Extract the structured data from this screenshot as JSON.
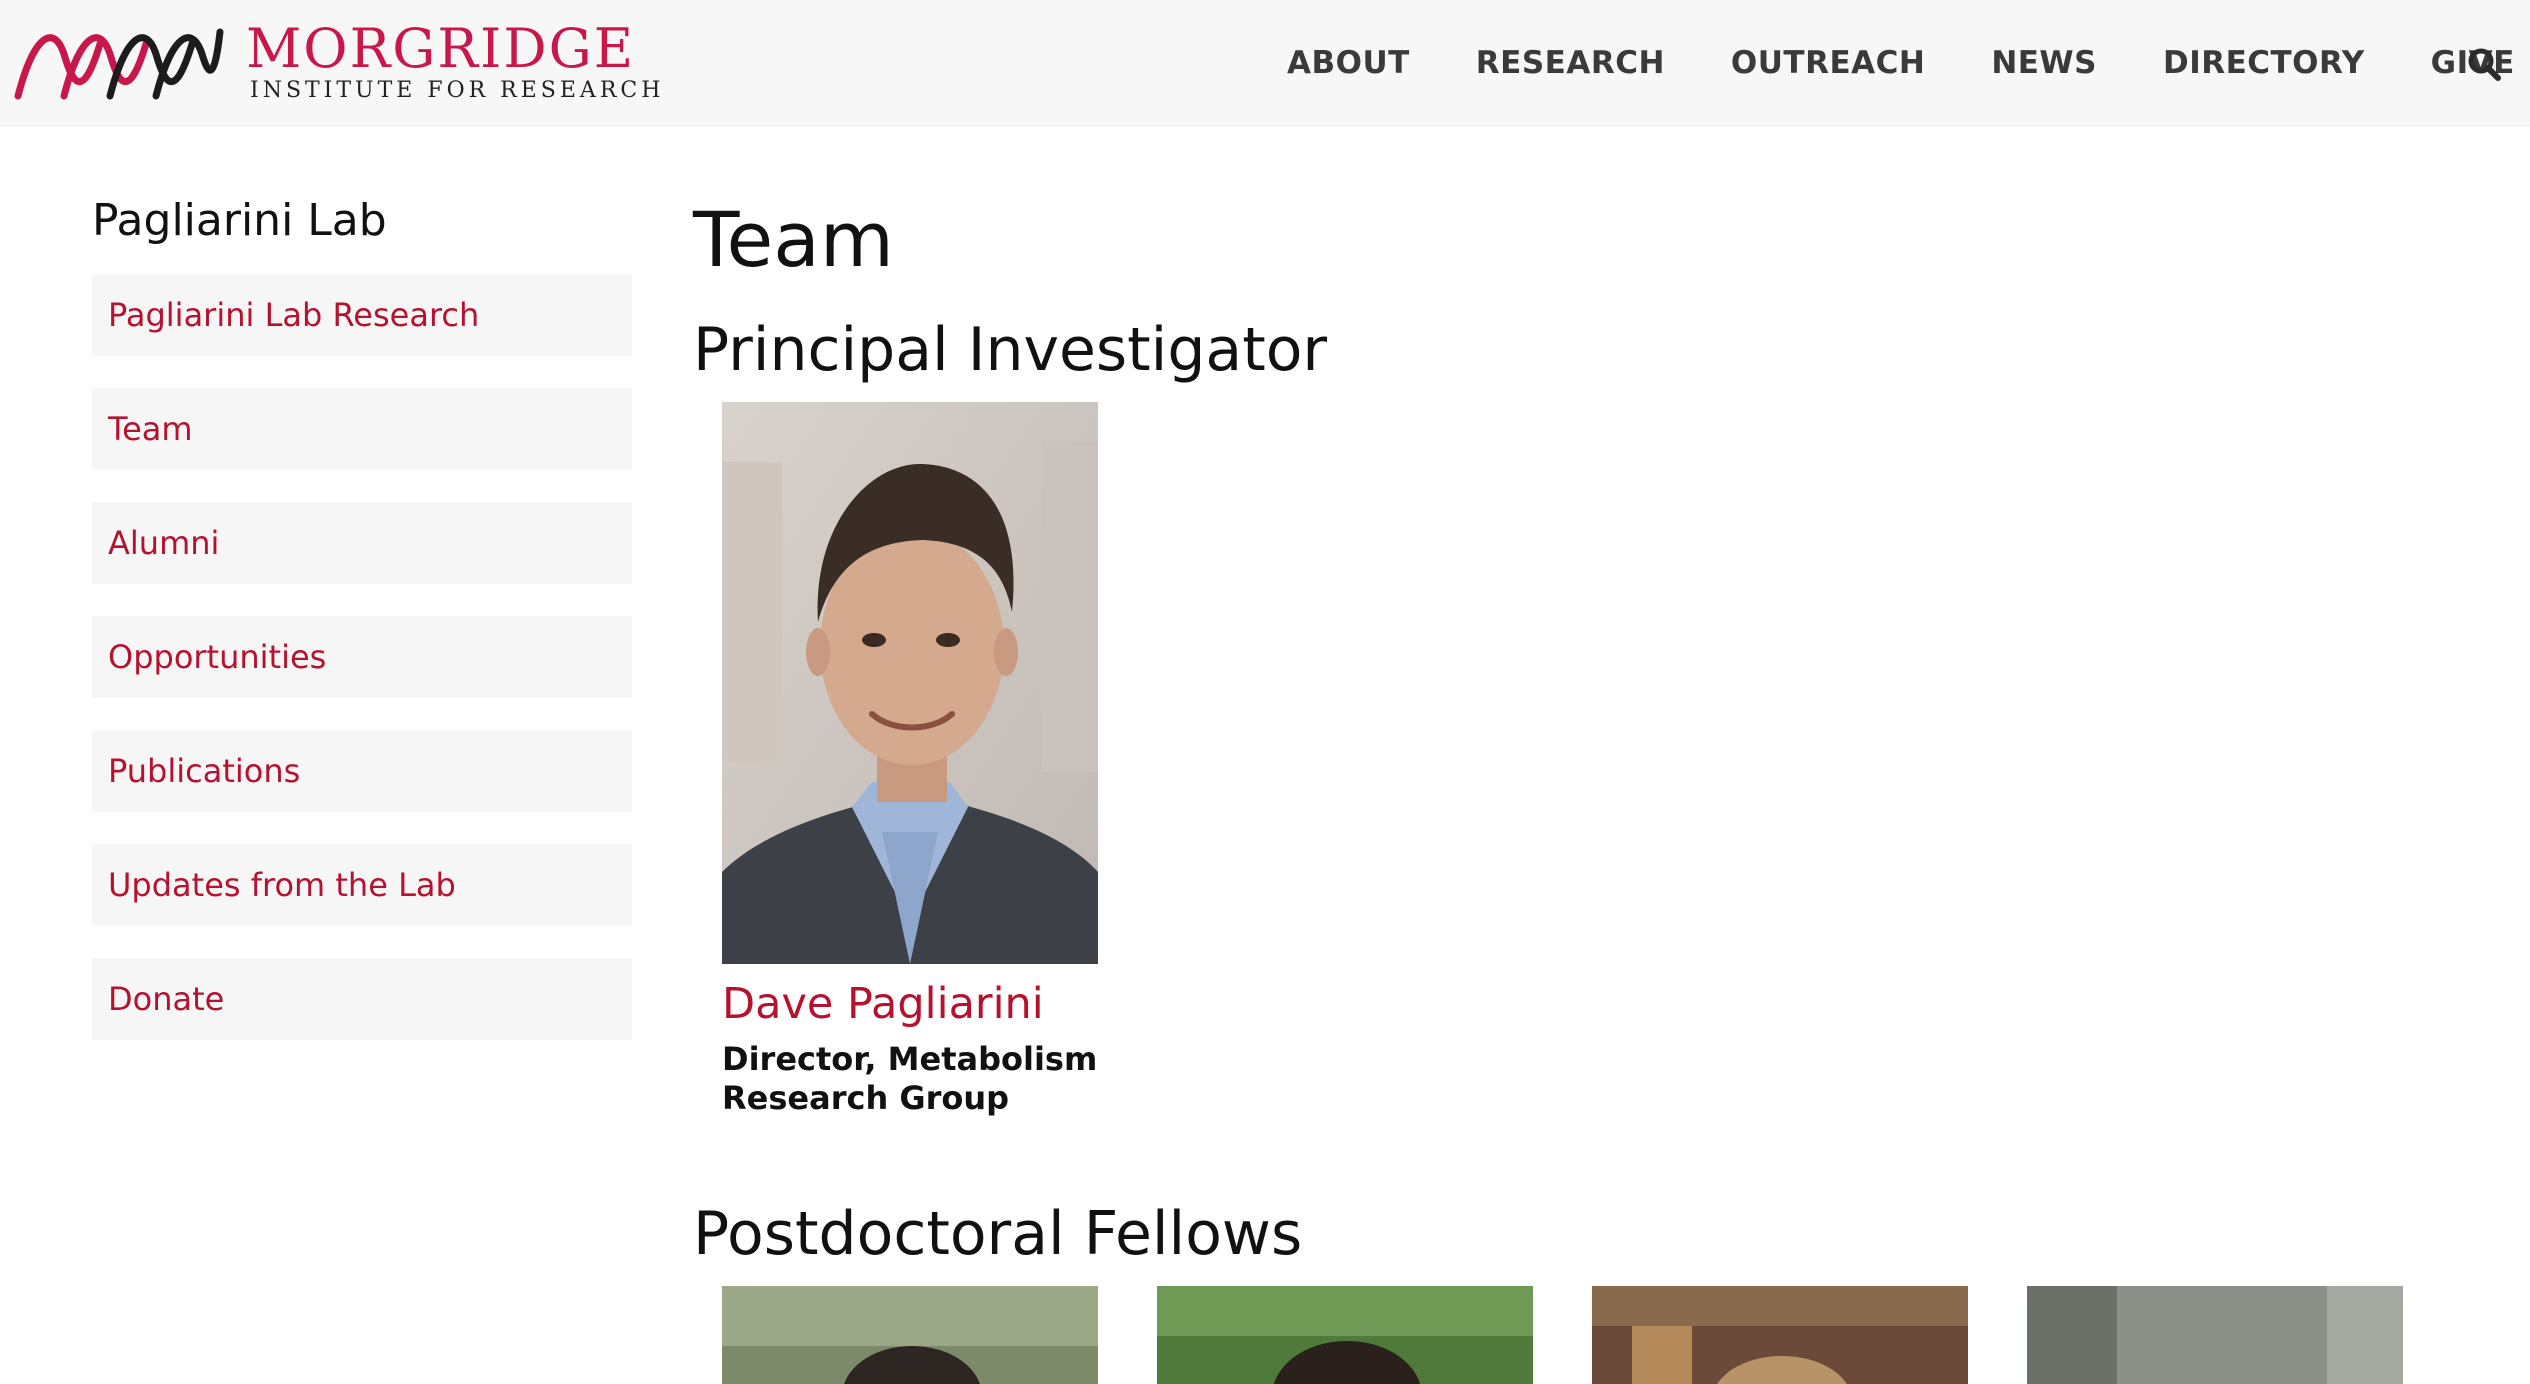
{
  "brand": {
    "name": "MORGRIDGE",
    "tagline": "INSTITUTE FOR RESEARCH",
    "accent_color": "#c8174b",
    "link_color": "#b5122f"
  },
  "nav": {
    "items": [
      {
        "label": "ABOUT"
      },
      {
        "label": "RESEARCH"
      },
      {
        "label": "OUTREACH"
      },
      {
        "label": "NEWS"
      },
      {
        "label": "DIRECTORY"
      },
      {
        "label": "GIVE"
      }
    ],
    "search_icon": "search-icon"
  },
  "sidebar": {
    "title": "Pagliarini Lab",
    "items": [
      {
        "label": "Pagliarini Lab Research"
      },
      {
        "label": "Team"
      },
      {
        "label": "Alumni"
      },
      {
        "label": "Opportunities"
      },
      {
        "label": "Publications"
      },
      {
        "label": "Updates from the Lab"
      },
      {
        "label": "Donate"
      }
    ]
  },
  "main": {
    "title": "Team",
    "pi_heading": "Principal Investigator",
    "pi": {
      "name": "Dave Pagliarini",
      "role": "Director, Metabolism Research Group"
    },
    "postdoc_heading": "Postdoctoral Fellows"
  }
}
